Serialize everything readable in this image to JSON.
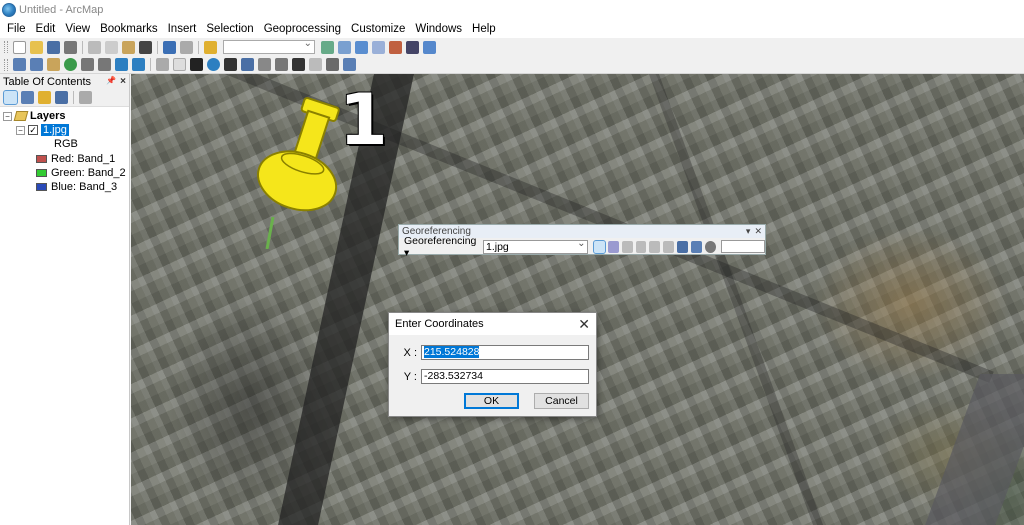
{
  "window": {
    "title": "Untitled - ArcMap"
  },
  "menu": [
    "File",
    "Edit",
    "View",
    "Bookmarks",
    "Insert",
    "Selection",
    "Geoprocessing",
    "Customize",
    "Windows",
    "Help"
  ],
  "toc": {
    "title": "Table Of Contents",
    "pin": "📌",
    "close": "×",
    "root": "Layers",
    "layer": "1.jpg",
    "band_group": "RGB",
    "bands": [
      {
        "label": "Red:",
        "band": "Band_1",
        "color": "#c0504d"
      },
      {
        "label": "Green:",
        "band": "Band_2",
        "color": "#33cc33"
      },
      {
        "label": "Blue:",
        "band": "Band_3",
        "color": "#2a4ab8"
      }
    ]
  },
  "map": {
    "control_point_number": "1"
  },
  "georef_toolbar": {
    "title": "Georeferencing",
    "menu_label": "Georeferencing ▾",
    "layer_value": "1.jpg"
  },
  "dialog": {
    "title": "Enter Coordinates",
    "close": "✕",
    "x_label": "X :",
    "x_value": "215.524828",
    "y_label": "Y :",
    "y_value": "-283.532734",
    "ok": "OK",
    "cancel": "Cancel"
  },
  "colors": {
    "selection": "#0078d7",
    "pin": "#f5e61b"
  }
}
